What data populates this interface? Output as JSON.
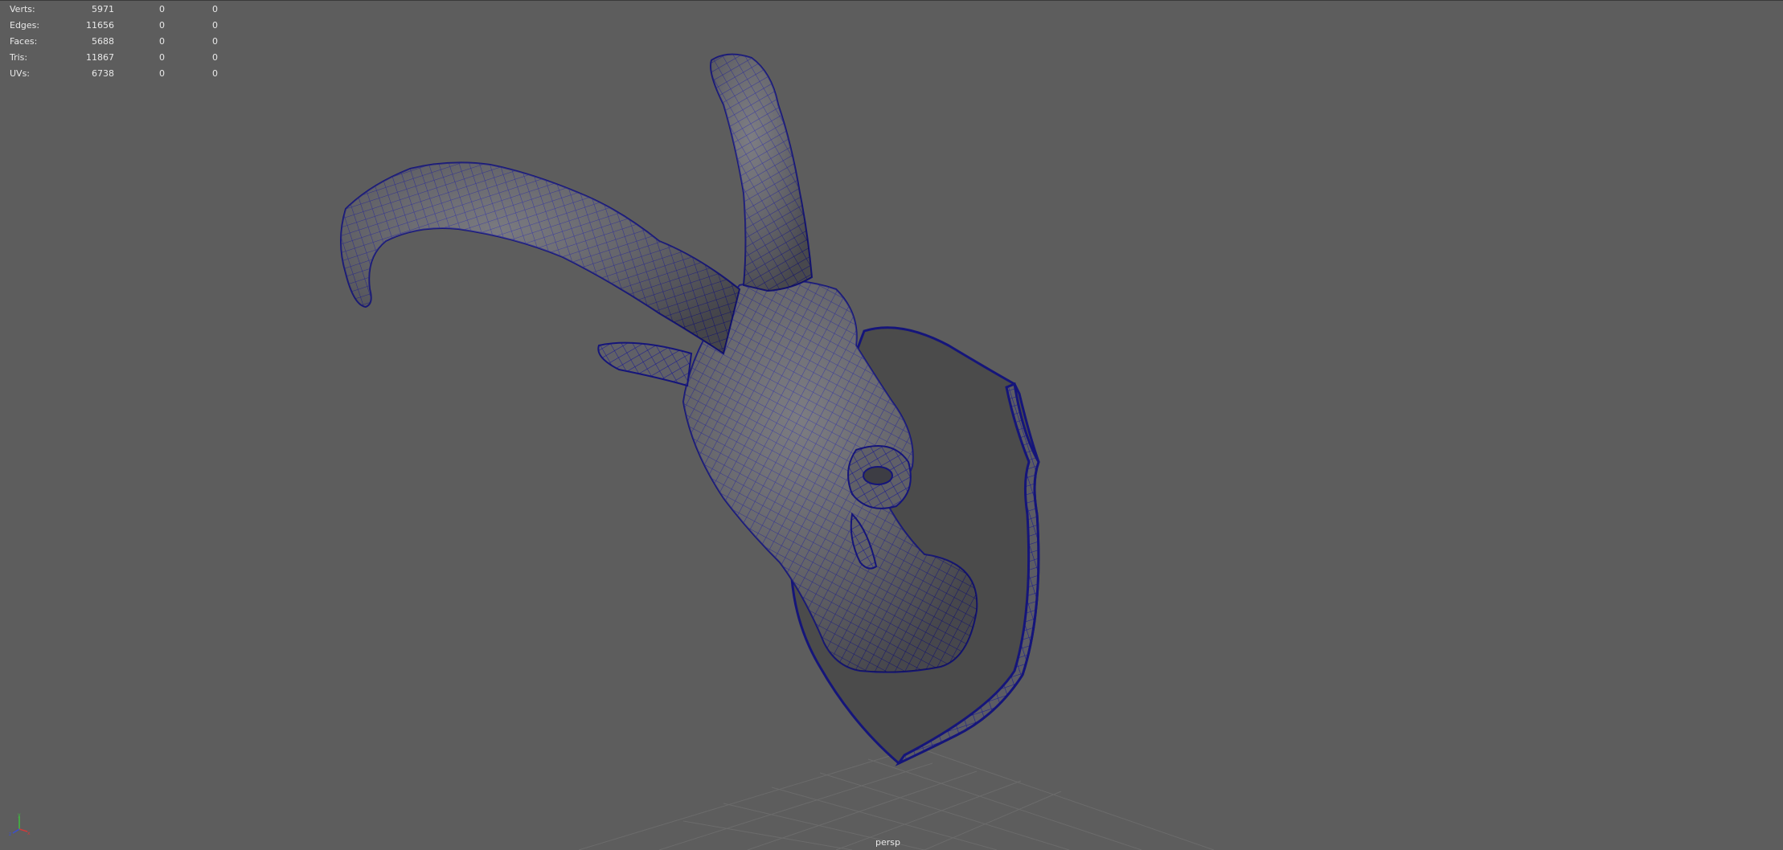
{
  "stats": [
    {
      "label": "Verts:",
      "v1": "5971",
      "v2": "0",
      "v3": "0"
    },
    {
      "label": "Edges:",
      "v1": "11656",
      "v2": "0",
      "v3": "0"
    },
    {
      "label": "Faces:",
      "v1": "5688",
      "v2": "0",
      "v3": "0"
    },
    {
      "label": "Tris:",
      "v1": "11867",
      "v2": "0",
      "v3": "0"
    },
    {
      "label": "UVs:",
      "v1": "6738",
      "v2": "0",
      "v3": "0"
    }
  ],
  "camera": {
    "name": "persp"
  },
  "colors": {
    "background": "#5d5d5d",
    "wireframe": "#1a1a8c",
    "mesh": "#5f5f66",
    "plaque": "#4a4a4a",
    "grid": "#6a6a6a"
  }
}
